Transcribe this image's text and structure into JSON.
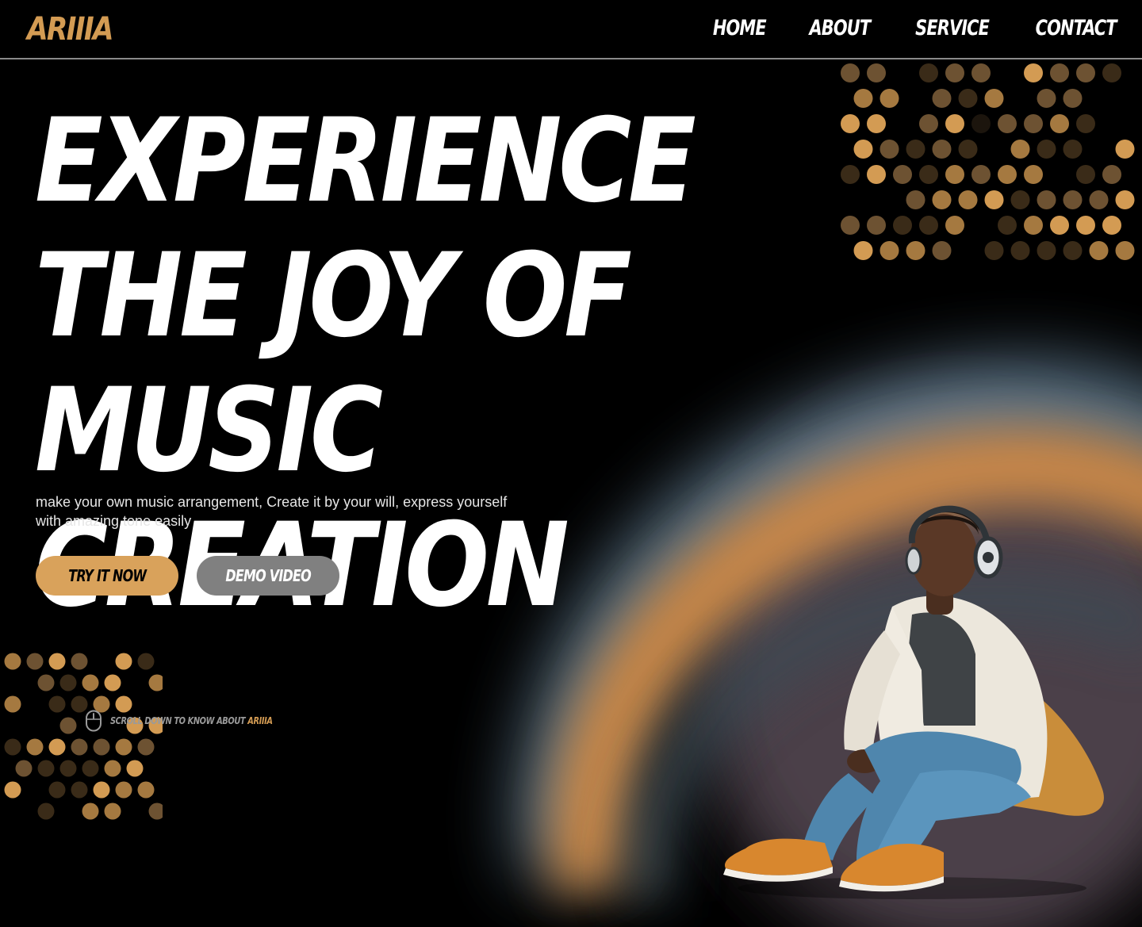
{
  "brand": {
    "logo_text": "ARIIIA"
  },
  "nav": {
    "links": [
      {
        "label": "HOME"
      },
      {
        "label": "ABOUT"
      },
      {
        "label": "SERVICE"
      },
      {
        "label": "CONTACT"
      }
    ]
  },
  "hero": {
    "title": "EXPERIENCE THE JOY OF MUSIC CREATION",
    "subtitle": "make your own music arrangement, Create it by your will, express yourself with amazing tone easily",
    "primary_button": "TRY IT NOW",
    "secondary_button": "DEMO VIDEO"
  },
  "scroll_hint": {
    "text": "SCROLL DOWN TO KNOW ABOUT",
    "brand": "ARIIIA"
  },
  "colors": {
    "accent": "#d9a25b",
    "background": "#000000",
    "secondary_button": "#808080",
    "glow_blue": "#6f8ea5",
    "glow_orange": "#d58c44"
  },
  "icons": {
    "scroll": "mouse-icon"
  }
}
